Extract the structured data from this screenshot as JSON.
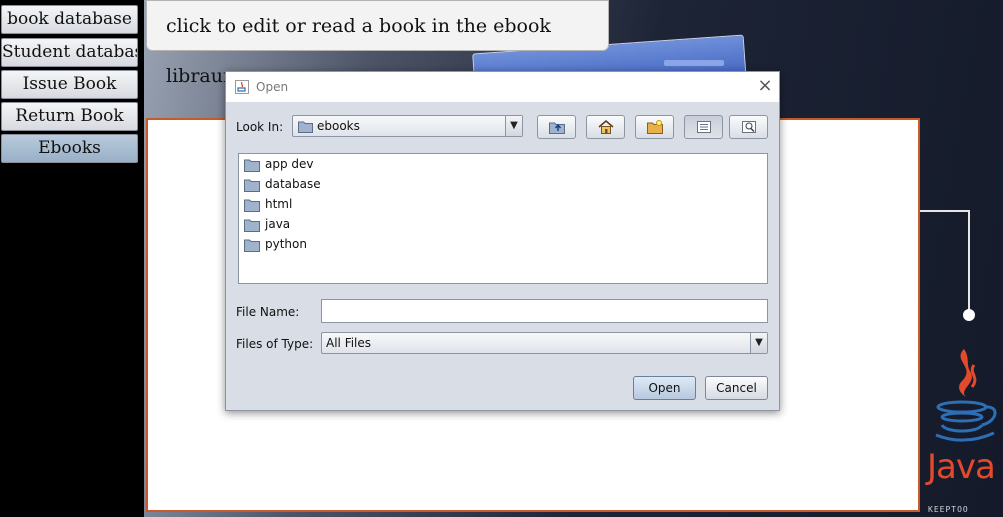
{
  "nav": {
    "items": [
      {
        "label": "book database"
      },
      {
        "label": "Student database"
      },
      {
        "label": "Issue Book"
      },
      {
        "label": "Return Book"
      },
      {
        "label": "Ebooks"
      }
    ],
    "active_index": 4
  },
  "header": {
    "text": "click to edit or read a book in the ebook libraury"
  },
  "dialog": {
    "title": "Open",
    "look_in_label": "Look In:",
    "look_in_value": "ebooks",
    "toolbar": [
      "up-one-level-icon",
      "home-icon",
      "new-folder-icon",
      "list-view-icon",
      "details-view-icon"
    ],
    "folders": [
      "app dev",
      "database",
      "html",
      "java",
      "python"
    ],
    "file_name_label": "File Name:",
    "file_name_value": "",
    "file_type_label": "Files of Type:",
    "file_type_value": "All Files",
    "open_label": "Open",
    "cancel_label": "Cancel"
  },
  "branding": {
    "java_word": "Java",
    "brand_text": "KEEPTOO"
  },
  "colors": {
    "content_border": "#c75a2a",
    "java_red": "#e34a2c",
    "java_blue": "#2c6fb6",
    "active_nav": "#a8bed3"
  }
}
